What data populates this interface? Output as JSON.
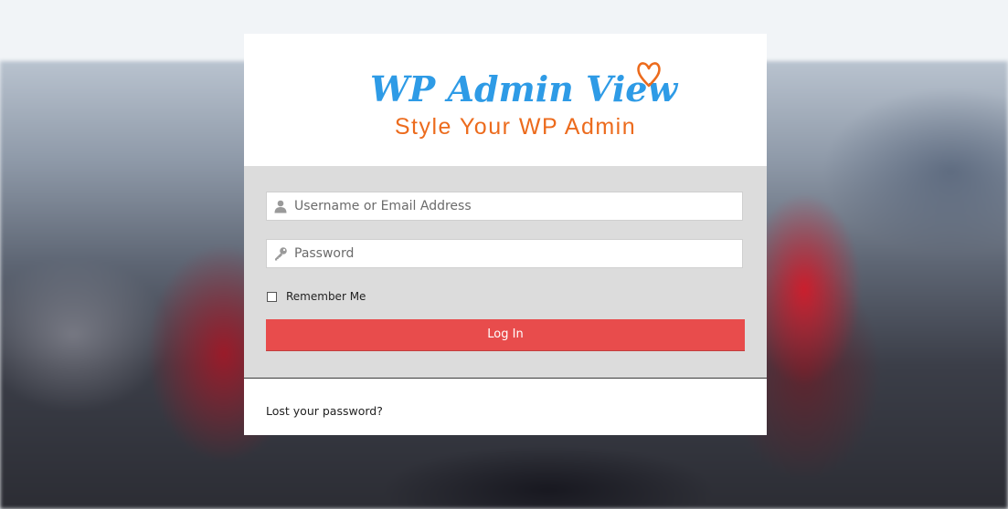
{
  "branding": {
    "logo_title": "WP Admin View",
    "tagline": "Style Your WP Admin",
    "title_color": "#2e9be6",
    "tagline_color": "#ec6b1d",
    "heart_icon": "heart-outline-icon"
  },
  "login_form": {
    "username": {
      "placeholder": "Username or Email Address",
      "value": "",
      "icon": "user-icon"
    },
    "password": {
      "placeholder": "Password",
      "value": "",
      "icon": "key-icon"
    },
    "remember_label": "Remember Me",
    "remember_checked": false,
    "submit_label": "Log In",
    "submit_color": "#e84c4c"
  },
  "footer": {
    "lost_password_label": "Lost your password?"
  }
}
